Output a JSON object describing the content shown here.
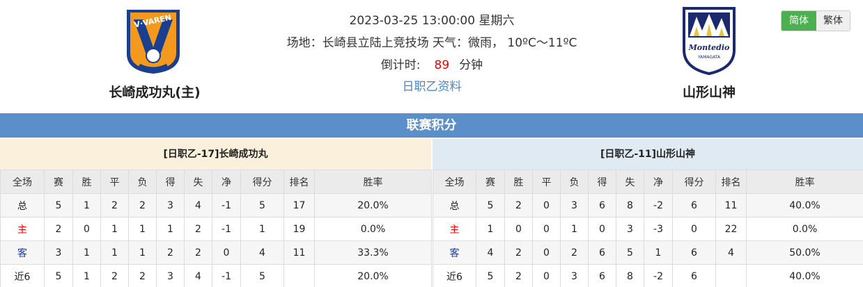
{
  "match": {
    "datetime": "2023-03-25 13:00:00 星期六",
    "venue_weather": "场地：长崎县立陆上竞技场 天气：微雨， 10ºC～11ºC",
    "countdown_label": "倒计时:",
    "countdown_value": "89",
    "countdown_unit": "分钟",
    "league_link": "日职乙资料"
  },
  "home_team": {
    "name": "长崎成功丸(主)",
    "logo_icon": "v-varen-nagasaki-logo"
  },
  "away_team": {
    "name": "山形山神",
    "logo_icon": "montedio-yamagata-logo"
  },
  "lang": {
    "simplified": "简体",
    "traditional": "繁体"
  },
  "standings": {
    "title": "联赛积分",
    "headers": [
      "全场",
      "赛",
      "胜",
      "平",
      "负",
      "得",
      "失",
      "净",
      "得分",
      "排名",
      "胜率"
    ],
    "home": {
      "title": "[日职乙-17]长崎成功丸",
      "rows": [
        [
          "总",
          "5",
          "1",
          "2",
          "2",
          "3",
          "4",
          "-1",
          "5",
          "17",
          "20.0%"
        ],
        [
          "主",
          "2",
          "0",
          "1",
          "1",
          "1",
          "2",
          "-1",
          "1",
          "19",
          "0.0%"
        ],
        [
          "客",
          "3",
          "1",
          "1",
          "1",
          "2",
          "2",
          "0",
          "4",
          "11",
          "33.3%"
        ],
        [
          "近6",
          "5",
          "1",
          "2",
          "2",
          "3",
          "4",
          "-1",
          "5",
          "",
          "20.0%"
        ]
      ]
    },
    "away": {
      "title": "[日职乙-11]山形山神",
      "rows": [
        [
          "总",
          "5",
          "2",
          "0",
          "3",
          "6",
          "8",
          "-2",
          "6",
          "11",
          "40.0%"
        ],
        [
          "主",
          "1",
          "0",
          "0",
          "1",
          "0",
          "3",
          "-3",
          "0",
          "22",
          "0.0%"
        ],
        [
          "客",
          "4",
          "2",
          "0",
          "2",
          "6",
          "5",
          "1",
          "6",
          "4",
          "50.0%"
        ],
        [
          "近6",
          "5",
          "2",
          "0",
          "3",
          "6",
          "8",
          "-2",
          "6",
          "",
          "40.0%"
        ]
      ]
    }
  },
  "colors": {
    "header_bar": "#5b8fca",
    "home_panel": "#fbf0dc",
    "away_panel": "#e0eaf3",
    "accent_red": "#e00000",
    "accent_blue": "#1a3d9e",
    "active_lang": "#4caf50"
  }
}
